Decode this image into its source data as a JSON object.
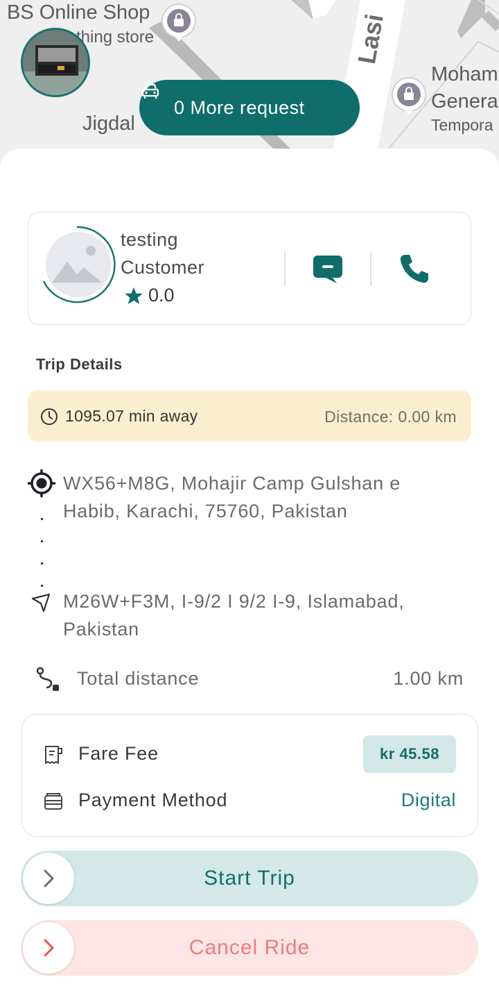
{
  "map": {
    "labels": {
      "shop_name": "BS Online Shop",
      "shop_sub": "thing store",
      "street": "Lasi",
      "place": "Jigdal",
      "right_1": "Moham",
      "right_2": "Genera",
      "right_3": "Tempora"
    },
    "more_request_label": "0 More request"
  },
  "customer": {
    "name": "testing",
    "role": "Customer",
    "rating": "0.0"
  },
  "trip": {
    "section_title": "Trip Details",
    "eta": "1095.07 min away",
    "distance_label": "Distance: 0.00 km",
    "pickup_address": "WX56+M8G, Mohajir Camp Gulshan e Habib, Karachi, 75760, Pakistan",
    "dropoff_address": "M26W+F3M, I-9/2 I 9/2 I-9, Islamabad, Pakistan",
    "total_distance_label": "Total distance",
    "total_distance_value": "1.00 km"
  },
  "fare": {
    "fare_label": "Fare Fee",
    "fare_value": "kr 45.58",
    "payment_label": "Payment Method",
    "payment_value": "Digital"
  },
  "actions": {
    "start_label": "Start Trip",
    "cancel_label": "Cancel Ride"
  },
  "colors": {
    "primary": "#0f6e69",
    "eta_bg": "#fcefd0",
    "cancel_text": "#ec7c77"
  }
}
